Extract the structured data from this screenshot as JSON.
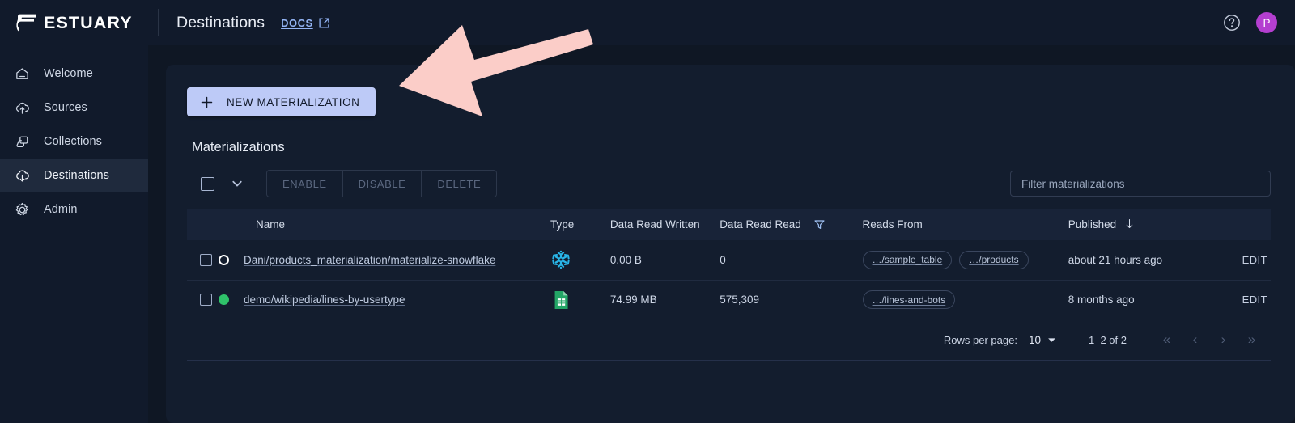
{
  "topbar": {
    "brand": "ESTUARY",
    "brand_logo_icon": "estuary-logo",
    "page_title": "Destinations",
    "docs_label": "DOCS",
    "docs_external_icon": "external-link-icon",
    "help_icon": "help-circle-icon",
    "avatar_initial": "P",
    "avatar_color": "#b43fd0"
  },
  "sidebar": {
    "items": [
      {
        "label": "Welcome",
        "icon": "home-icon",
        "active": false
      },
      {
        "label": "Sources",
        "icon": "cloud-upload-icon",
        "active": false
      },
      {
        "label": "Collections",
        "icon": "collections-icon",
        "active": false
      },
      {
        "label": "Destinations",
        "icon": "cloud-download-icon",
        "active": true
      },
      {
        "label": "Admin",
        "icon": "gear-icon",
        "active": false
      }
    ]
  },
  "main": {
    "new_button_label": "NEW MATERIALIZATION",
    "new_button_icon": "plus-icon",
    "new_button_color": "#bdcaf7",
    "section_title": "Materializations",
    "toolbar": {
      "select_all_icon": "checkbox-unchecked-icon",
      "select_menu_icon": "chevron-down-icon",
      "buttons": [
        {
          "label": "ENABLE",
          "disabled": true
        },
        {
          "label": "DISABLE",
          "disabled": true
        },
        {
          "label": "DELETE",
          "disabled": true
        }
      ],
      "filter_placeholder": "Filter materializations",
      "filter_value": ""
    },
    "table": {
      "columns": [
        {
          "key": "check",
          "label": ""
        },
        {
          "key": "name",
          "label": "Name"
        },
        {
          "key": "type",
          "label": "Type"
        },
        {
          "key": "written",
          "label": "Data Read Written"
        },
        {
          "key": "read",
          "label": "Data Read Read",
          "icon": "filter-funnel-icon"
        },
        {
          "key": "reads",
          "label": "Reads From"
        },
        {
          "key": "pub",
          "label": "Published",
          "sort": "desc",
          "sort_icon": "arrow-down-icon"
        },
        {
          "key": "edit",
          "label": ""
        }
      ],
      "rows": [
        {
          "status": "open",
          "status_icon": "circle-outline-icon",
          "name": "Dani/products_materialization/materialize-snowflake",
          "type_icon": "snowflake-icon",
          "type_color": "#29b5e8",
          "written": "0.00 B",
          "read": "0",
          "reads_from": [
            "…/sample_table",
            "…/products"
          ],
          "published": "about 21 hours ago",
          "edit_label": "EDIT"
        },
        {
          "status": "active",
          "status_icon": "circle-filled-icon",
          "status_color": "#2fc26a",
          "name": "demo/wikipedia/lines-by-usertype",
          "type_icon": "google-sheets-icon",
          "type_color": "#23a566",
          "written": "74.99 MB",
          "read": "575,309",
          "reads_from": [
            "…/lines-and-bots"
          ],
          "published": "8 months ago",
          "edit_label": "EDIT"
        }
      ]
    },
    "pagination": {
      "rows_per_page_label": "Rows per page:",
      "rows_per_page_value": "10",
      "caret_icon": "caret-down-icon",
      "range_label": "1–2 of 2",
      "first_icon": "«",
      "prev_icon": "‹",
      "next_icon": "›",
      "last_icon": "»"
    }
  },
  "annotation": {
    "arrow_icon": "pointer-arrow-icon",
    "arrow_color": "#fbcdc8",
    "points_to": "new-materialization-button"
  }
}
